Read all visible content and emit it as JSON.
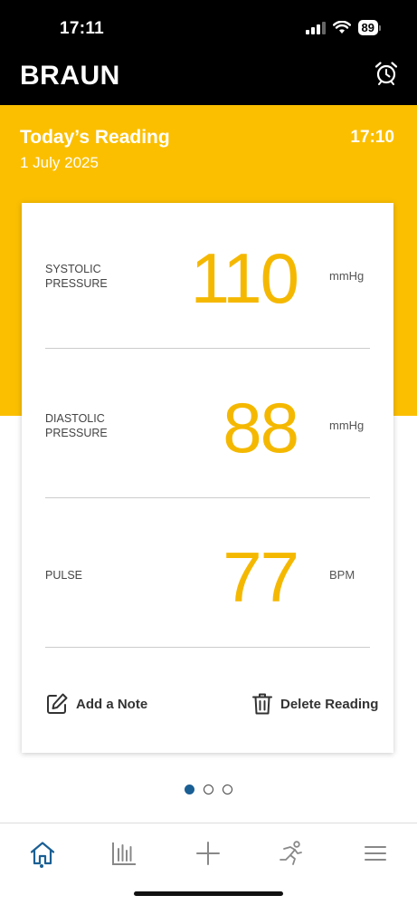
{
  "status": {
    "time": "17:11",
    "battery": "89"
  },
  "header": {
    "brand": "BRAUN"
  },
  "reading": {
    "title": "Today’s Reading",
    "date": "1 July 2025",
    "time": "17:10"
  },
  "metrics": [
    {
      "label_line1": "SYSTOLIC",
      "label_line2": "PRESSURE",
      "value": "110",
      "unit": "mmHg"
    },
    {
      "label_line1": "DIASTOLIC",
      "label_line2": "PRESSURE",
      "value": "88",
      "unit": "mmHg"
    },
    {
      "label_line1": "PULSE",
      "label_line2": "",
      "value": "77",
      "unit": "BPM"
    }
  ],
  "actions": {
    "add_note": "Add a Note",
    "delete_reading": "Delete Reading"
  },
  "pager": {
    "pages": 3,
    "active": 1
  },
  "colors": {
    "accent_yellow": "#fbbf00",
    "value_yellow": "#f5b800",
    "nav_blue": "#1a5f94"
  },
  "tabs": [
    "home-icon",
    "chart-icon",
    "add-icon",
    "activity-icon",
    "menu-icon"
  ]
}
